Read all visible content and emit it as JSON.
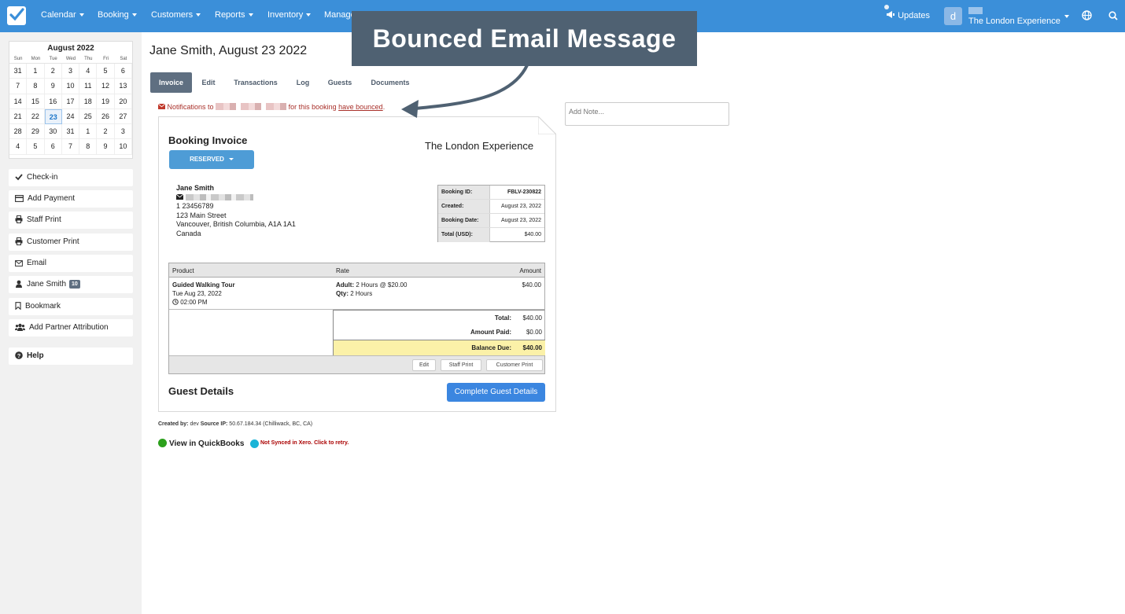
{
  "nav": {
    "items": [
      {
        "label": "Calendar"
      },
      {
        "label": "Booking"
      },
      {
        "label": "Customers"
      },
      {
        "label": "Reports"
      },
      {
        "label": "Inventory"
      },
      {
        "label": "Manage"
      }
    ],
    "updates_label": "Updates",
    "avatar_letter": "d",
    "account_name": "The London Experience",
    "colors": {
      "bar": "#3b8fd9"
    }
  },
  "calendar": {
    "title": "August 2022",
    "weekdays": [
      "Sun",
      "Mon",
      "Tue",
      "Wed",
      "Thu",
      "Fri",
      "Sat"
    ],
    "days": [
      "31",
      "1",
      "2",
      "3",
      "4",
      "5",
      "6",
      "7",
      "8",
      "9",
      "10",
      "11",
      "12",
      "13",
      "14",
      "15",
      "16",
      "17",
      "18",
      "19",
      "20",
      "21",
      "22",
      "23",
      "24",
      "25",
      "26",
      "27",
      "28",
      "29",
      "30",
      "31",
      "1",
      "2",
      "3",
      "4",
      "5",
      "6",
      "7",
      "8",
      "9",
      "10"
    ],
    "selected": "23"
  },
  "sidebar": {
    "items": [
      {
        "label": "Check-in",
        "icon": "check-icon"
      },
      {
        "label": "Add Payment",
        "icon": "credit-card-icon"
      },
      {
        "label": "Staff Print",
        "icon": "printer-icon"
      },
      {
        "label": "Customer Print",
        "icon": "printer-icon"
      },
      {
        "label": "Email",
        "icon": "envelope-icon"
      },
      {
        "label": "Jane Smith",
        "icon": "user-icon",
        "badge": "10"
      },
      {
        "label": "Bookmark",
        "icon": "bookmark-icon"
      },
      {
        "label": "Add Partner Attribution",
        "icon": "users-icon"
      }
    ],
    "help_label": "Help"
  },
  "page": {
    "title": "Jane Smith, August 23 2022"
  },
  "tabs": [
    {
      "label": "Invoice"
    },
    {
      "label": "Edit"
    },
    {
      "label": "Transactions"
    },
    {
      "label": "Log"
    },
    {
      "label": "Guests"
    },
    {
      "label": "Documents"
    }
  ],
  "warning": {
    "prefix": "Notifications to",
    "middle": "for this booking",
    "link": "have bounced",
    "suffix": "."
  },
  "invoice": {
    "title": "Booking Invoice",
    "company": "The London Experience",
    "status_label": "RESERVED",
    "customer": {
      "name": "Jane Smith",
      "phone": "1 23456789",
      "address1": "123 Main Street",
      "address2": "Vancouver, British Columbia, A1A 1A1",
      "country": "Canada"
    },
    "info": [
      {
        "key": "Booking ID:",
        "value": "FBLV-230822"
      },
      {
        "key": "Created:",
        "value": "August 23, 2022"
      },
      {
        "key": "Booking Date:",
        "value": "August 23, 2022"
      },
      {
        "key": "Total (USD):",
        "value": "$40.00"
      }
    ],
    "columns": {
      "product": "Product",
      "rate": "Rate",
      "amount": "Amount"
    },
    "item": {
      "product": "Guided Walking Tour",
      "date": "Tue Aug 23, 2022",
      "time": "02:00 PM",
      "rate_adult_label": "Adult:",
      "rate_adult_value": "2 Hours @ $20.00",
      "qty_label": "Qty:",
      "qty_value": "2 Hours",
      "amount": "$40.00"
    },
    "totals": {
      "total_label": "Total:",
      "total_value": "$40.00",
      "paid_label": "Amount Paid:",
      "paid_value": "$0.00",
      "balance_label": "Balance Due:",
      "balance_value": "$40.00"
    },
    "footer_buttons": {
      "edit": "Edit",
      "staff_print": "Staff Print",
      "customer_print": "Customer Print"
    },
    "guest_title": "Guest Details",
    "guest_button": "Complete Guest Details"
  },
  "meta": {
    "created_by_label": "Created by:",
    "created_by": "dev",
    "source_ip_label": "Source IP:",
    "source_ip": "50.67.184.34 (Chilliwack, BC, CA)",
    "quickbooks_label": "View in QuickBooks",
    "xero_label": "Not Synced in Xero. Click to retry."
  },
  "note": {
    "placeholder": "Add Note..."
  },
  "callout": {
    "title": "Bounced Email Message",
    "color": "#4f6172"
  }
}
